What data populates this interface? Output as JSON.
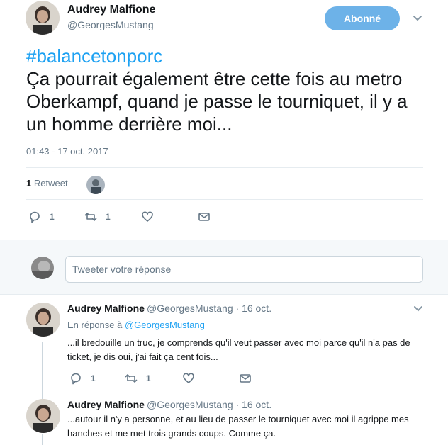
{
  "main_tweet": {
    "author_name": "Audrey Malfione",
    "author_handle": "@GeorgesMustang",
    "follow_label": "Abonné",
    "hashtag": "#balancetonporc",
    "text": "Ça pourrait également être cette fois au metro Oberkampf, quand je passe le tourniquet, il y a un homme derrière moi...",
    "timestamp": "01:43 - 17 oct. 2017",
    "retweet_count": "1",
    "retweet_label": "Retweet",
    "reply_count": "1",
    "rt_count": "1"
  },
  "reply_box": {
    "placeholder": "Tweeter votre réponse"
  },
  "replies": [
    {
      "author_name": "Audrey Malfione",
      "author_handle": "@GeorgesMustang",
      "date": "16 oct.",
      "separator": "·",
      "in_reply_prefix": "En réponse à",
      "in_reply_handle": "@GeorgesMustang",
      "text": "...il bredouille un truc, je comprends qu'il veut passer avec moi parce qu'il n'a pas de ticket, je dis oui, j'ai fait ça cent fois...",
      "reply_count": "1",
      "rt_count": "1"
    },
    {
      "author_name": "Audrey Malfione",
      "author_handle": "@GeorgesMustang",
      "date": "16 oct.",
      "separator": "·",
      "text": "...autour il n'y a personne, et au lieu de passer le tourniquet avec moi il agrippe mes hanches et me met trois grands coups. Comme ça."
    }
  ],
  "icons": {
    "reply": "reply-icon",
    "retweet": "retweet-icon",
    "like": "heart-icon",
    "dm": "envelope-icon",
    "more": "chevron-down-icon"
  },
  "colors": {
    "accent": "#1da1f2",
    "follow_button": "#6db2e8",
    "muted": "#657786"
  }
}
